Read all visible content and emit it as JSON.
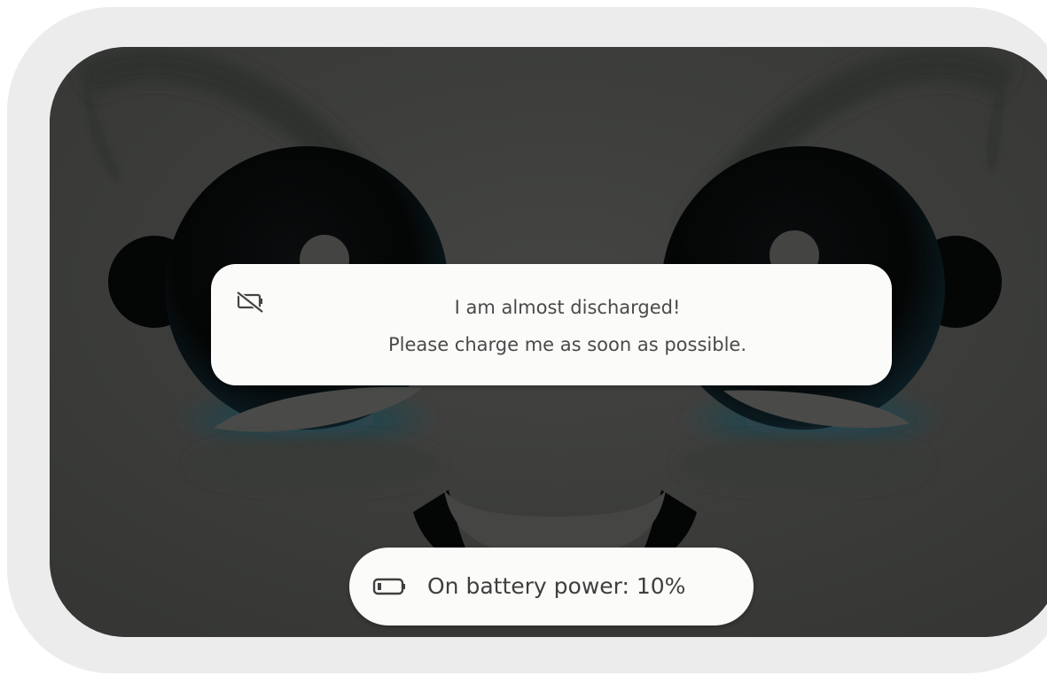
{
  "notification": {
    "icon": "battery-off-icon",
    "line1": "I am almost discharged!",
    "line2": "Please charge me as soon as possible."
  },
  "status": {
    "icon": "battery-low-icon",
    "label": "On battery power: 10%",
    "battery_level_percent": 10
  },
  "colors": {
    "bezel": "#ececec",
    "screen": "#3c3d3b",
    "toast_bg": "#fbfbf9",
    "eye": "#050607",
    "eye_glow": "#0e3a4a"
  }
}
